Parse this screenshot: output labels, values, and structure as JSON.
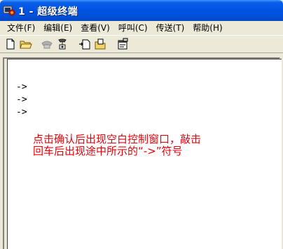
{
  "window": {
    "title": "1 - 超级终端",
    "icon": "hyperterminal-app-icon"
  },
  "menu": {
    "items": [
      {
        "label": "文件(F)"
      },
      {
        "label": "编辑(E)"
      },
      {
        "label": "查看(V)"
      },
      {
        "label": "呼叫(C)"
      },
      {
        "label": "传送(T)"
      },
      {
        "label": "帮助(H)"
      }
    ]
  },
  "toolbar": {
    "buttons": [
      {
        "icon": "new-document-icon"
      },
      {
        "icon": "open-folder-icon"
      },
      {
        "icon": "call-phone-icon"
      },
      {
        "icon": "disconnect-icon"
      },
      {
        "icon": "send-icon"
      },
      {
        "icon": "receive-icon"
      },
      {
        "icon": "properties-icon"
      }
    ]
  },
  "terminal": {
    "lines": [
      "->",
      "->",
      "->"
    ],
    "annotation_line1": "点击确认后出现空白控制窗口，敲击",
    "annotation_line2": "回车后出现途中所示的“->”符号",
    "annotation_color": "#e8000a"
  },
  "colors": {
    "titlebar": "#0054e3",
    "window_bg": "#ece9d8"
  }
}
